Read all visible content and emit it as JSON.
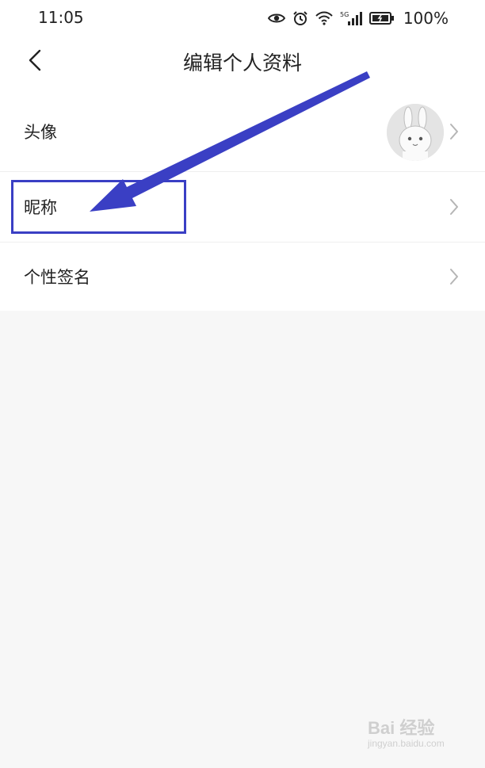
{
  "status_bar": {
    "time": "11:05",
    "battery": "100%",
    "icons": [
      "eye-icon",
      "alarm-icon",
      "wifi-icon",
      "signal-5g-icon",
      "battery-icon"
    ]
  },
  "header": {
    "title": "编辑个人资料",
    "back_icon": "chevron-left-icon"
  },
  "profile_items": [
    {
      "label": "头像",
      "type": "avatar"
    },
    {
      "label": "昵称",
      "type": "text"
    },
    {
      "label": "个性签名",
      "type": "text"
    }
  ],
  "annotation": {
    "color": "#3a3fc4",
    "target": "昵称"
  },
  "watermark": {
    "brand": "Bai 经验",
    "url": "jingyan.baidu.com"
  },
  "colors": {
    "background": "#f7f7f7",
    "surface": "#ffffff",
    "text": "#222222",
    "chevron": "#b5b5b5",
    "annotation": "#3a3fc4"
  }
}
